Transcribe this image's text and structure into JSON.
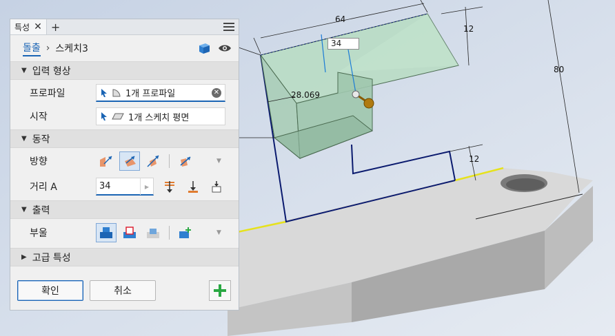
{
  "panel": {
    "tab_title": "특성",
    "tab_close": "✕",
    "tab_add": "+",
    "breadcrumb": {
      "feature": "돌출",
      "sketch": "스케치3"
    },
    "sections": {
      "input_shape": {
        "title": "입력 형상",
        "profile_label": "프로파일",
        "profile_value": "1개 프로파일",
        "start_label": "시작",
        "start_value": "1개 스케치 평면"
      },
      "behavior": {
        "title": "동작",
        "direction_label": "방향",
        "distance_label": "거리 A",
        "distance_value": "34"
      },
      "output": {
        "title": "출력",
        "boolean_label": "부울"
      },
      "advanced": {
        "title": "고급 특성"
      }
    },
    "buttons": {
      "ok": "확인",
      "cancel": "취소"
    }
  },
  "viewport": {
    "dimensions": {
      "top_width": "64",
      "top_right_height": "12",
      "depth": "80",
      "inner_width": "28.069",
      "lower_right_height": "12"
    },
    "distance_input": "34"
  },
  "colors": {
    "accent": "#1a64b4",
    "extrude_fill": "#b7dcc2",
    "sketch_line": "#0a1a6e",
    "plus_green": "#2aa843",
    "manipulator": "#b07a10"
  }
}
